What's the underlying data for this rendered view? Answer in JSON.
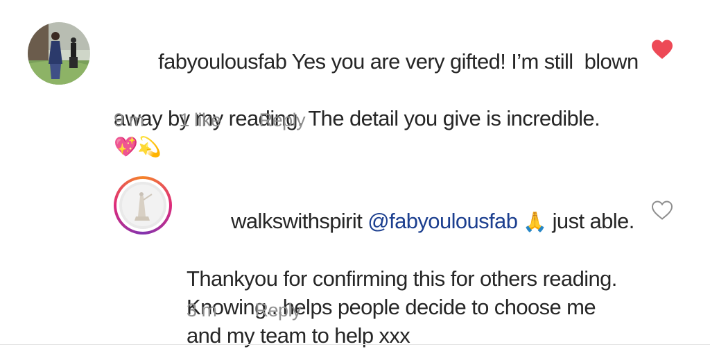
{
  "comment1": {
    "username": "fabyoulousfab",
    "line1": " Yes you are very gifted! I’m still  blown",
    "line2": "away by my reading. The detail you give is incredible.",
    "emojis": "💖💫",
    "time": "9 m",
    "likes": "1 like",
    "reply": "Reply",
    "liked": true,
    "heart_color": "#ed4956"
  },
  "comment2": {
    "username": "walkswithspirit",
    "mention": "@fabyoulousfab",
    "line1_rest": " just able.",
    "pray_emoji": "🙏",
    "line2": "Thankyou for confirming this for others reading.",
    "line3": "Knowing...helps people decide to choose me",
    "line4": "and my team to help xxx",
    "time": "3 m",
    "reply": "Reply",
    "liked": false
  },
  "colors": {
    "mention": "#1c3f8f",
    "meta": "#8e8e8e",
    "story_ring": [
      "#f58529",
      "#dd2a7b",
      "#8134af"
    ]
  },
  "icons": {
    "liked": "heart-filled-icon",
    "unliked": "heart-outline-icon"
  }
}
